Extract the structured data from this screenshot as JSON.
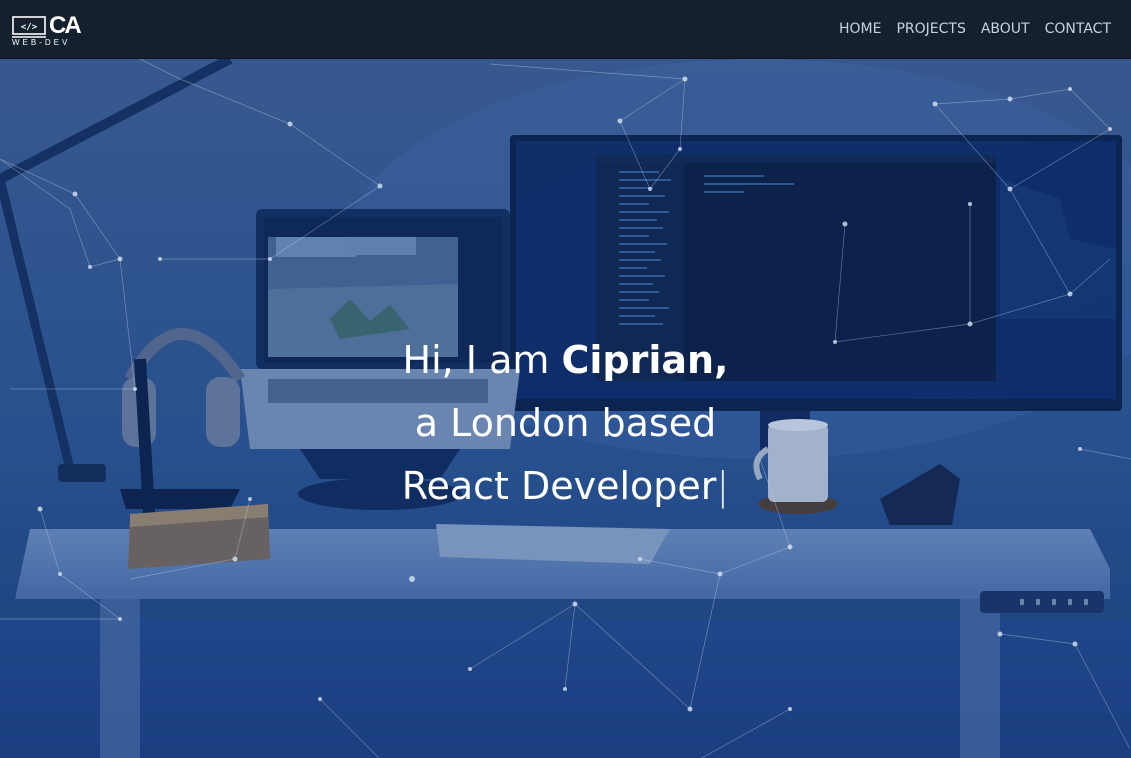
{
  "header": {
    "logo": {
      "monogram": "CA",
      "subtitle": "WEB-DEV",
      "icon": "code-monitor-icon",
      "code_symbol": "</>"
    },
    "nav": [
      {
        "label": "HOME"
      },
      {
        "label": "PROJECTS"
      },
      {
        "label": "ABOUT"
      },
      {
        "label": "CONTACT"
      }
    ]
  },
  "hero": {
    "greeting": "Hi, I am ",
    "name": "Ciprian,",
    "line2": "a London based",
    "line3": "React Developer",
    "cursor": "|",
    "background": "desk-setup-photo",
    "overlay_color": "#1b4a9c"
  },
  "colors": {
    "navbar_bg": "#14202d",
    "nav_text": "#c9d2dc",
    "hero_tint": "#1b3a68",
    "text": "#ffffff"
  }
}
